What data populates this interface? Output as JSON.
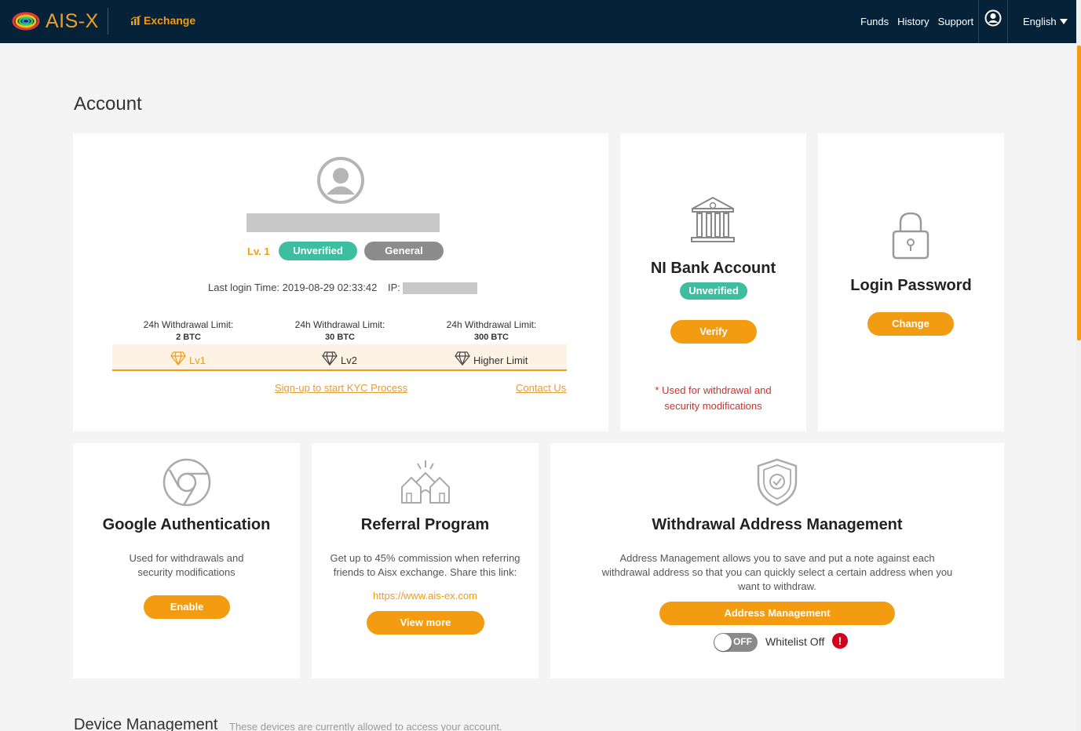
{
  "header": {
    "brand": "AIS-X",
    "exchange_label": "Exchange",
    "nav": [
      "Funds",
      "History",
      "Support"
    ],
    "language": "English"
  },
  "page": {
    "title": "Account"
  },
  "profile": {
    "level": "Lv. 1",
    "status_badge": "Unverified",
    "type_badge": "General",
    "last_login_label": "Last login Time: 2019-08-29 02:33:42",
    "ip_label": "IP:",
    "limits": [
      {
        "label": "24h Withdrawal Limit:",
        "value": "2 BTC",
        "tier": "Lv1"
      },
      {
        "label": "24h Withdrawal Limit:",
        "value": "30 BTC",
        "tier": "Lv2"
      },
      {
        "label": "24h Withdrawal Limit:",
        "value": "300 BTC",
        "tier": "Higher Limit"
      }
    ],
    "kyc_link": "Sign-up to start KYC Process",
    "contact_link": "Contact Us"
  },
  "bank": {
    "title": "NI Bank Account",
    "status": "Unverified",
    "button": "Verify",
    "note_line1": "* Used for withdrawal and",
    "note_line2": "security modifications"
  },
  "password": {
    "title": "Login Password",
    "button": "Change"
  },
  "google_auth": {
    "title": "Google Authentication",
    "desc_line1": "Used for withdrawals and",
    "desc_line2": "security modifications",
    "button": "Enable"
  },
  "referral": {
    "title": "Referral Program",
    "desc_line1": "Get up to 45% commission when referring",
    "desc_line2": "friends to Aisx exchange. Share this link:",
    "link": "https://www.ais-ex.com",
    "button": "View more"
  },
  "withdrawal": {
    "title": "Withdrawal Address Management",
    "desc_line1": "Address Management allows you to save and put a note against each",
    "desc_line2": "withdrawal address so that you can quickly select a certain address when you",
    "desc_line3": "want to withdraw.",
    "button": "Address Management",
    "toggle_label": "OFF",
    "whitelist_label": "Whitelist Off",
    "warning_symbol": "!"
  },
  "device": {
    "title": "Device Management",
    "subtitle": "These devices are currently allowed to access your account."
  },
  "colors": {
    "nav_bg": "#062238",
    "accent": "#f39c12",
    "verified_green": "#3dbea0",
    "general_gray": "#8c8c8c",
    "warning_red": "#d0021b"
  }
}
